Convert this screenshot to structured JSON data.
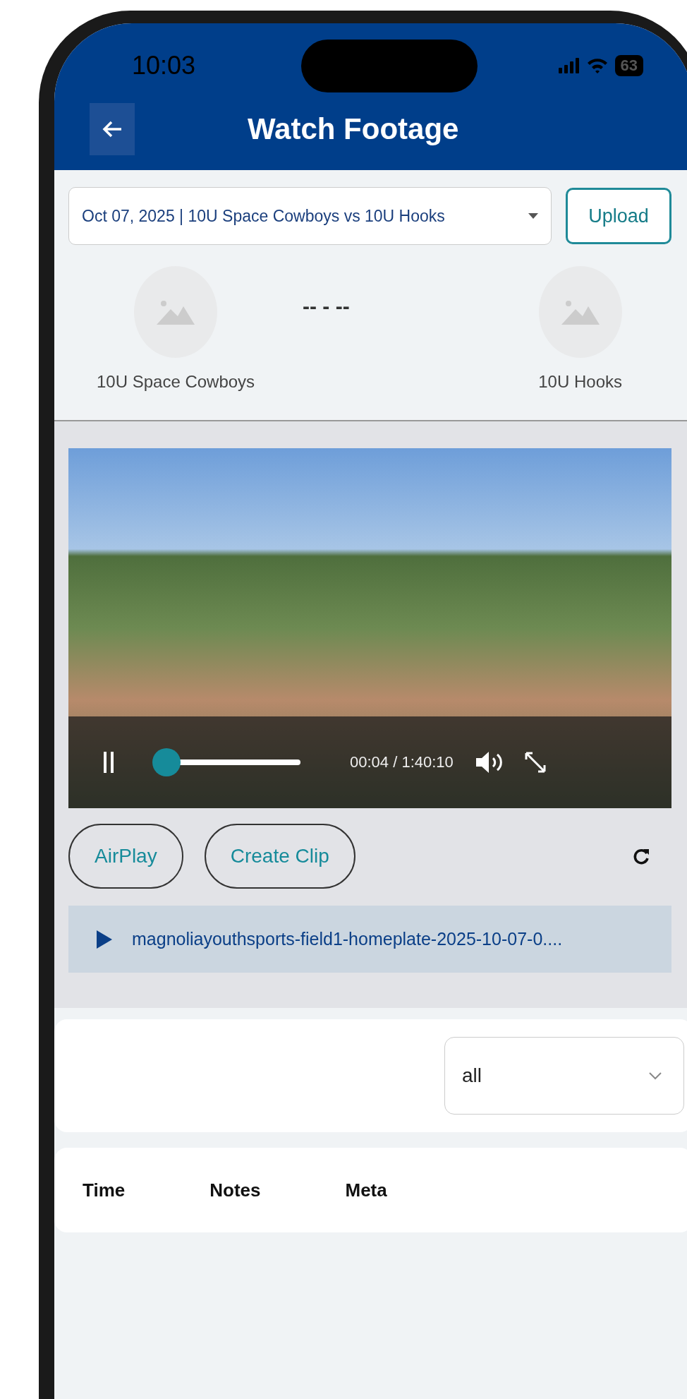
{
  "status_bar": {
    "time": "10:03",
    "battery": "63"
  },
  "header": {
    "title": "Watch Footage"
  },
  "game_select": {
    "value": "Oct 07, 2025 | 10U Space Cowboys vs 10U Hooks"
  },
  "upload_button": {
    "label": "Upload"
  },
  "teams": [
    {
      "name": "10U Space Cowboys"
    },
    {
      "name": "10U Hooks"
    }
  ],
  "score": "-- - --",
  "video": {
    "time": "00:04 / 1:40:10",
    "level": 0.02
  },
  "actions": [
    {
      "label": "AirPlay"
    },
    {
      "label": "Create Clip"
    }
  ],
  "file": {
    "name": "magnoliayouthsports-field1-homeplate-2025-10-07-0...."
  },
  "filter": {
    "value": "all"
  },
  "table": {
    "columns": [
      "Time",
      "Notes",
      "Meta"
    ]
  }
}
